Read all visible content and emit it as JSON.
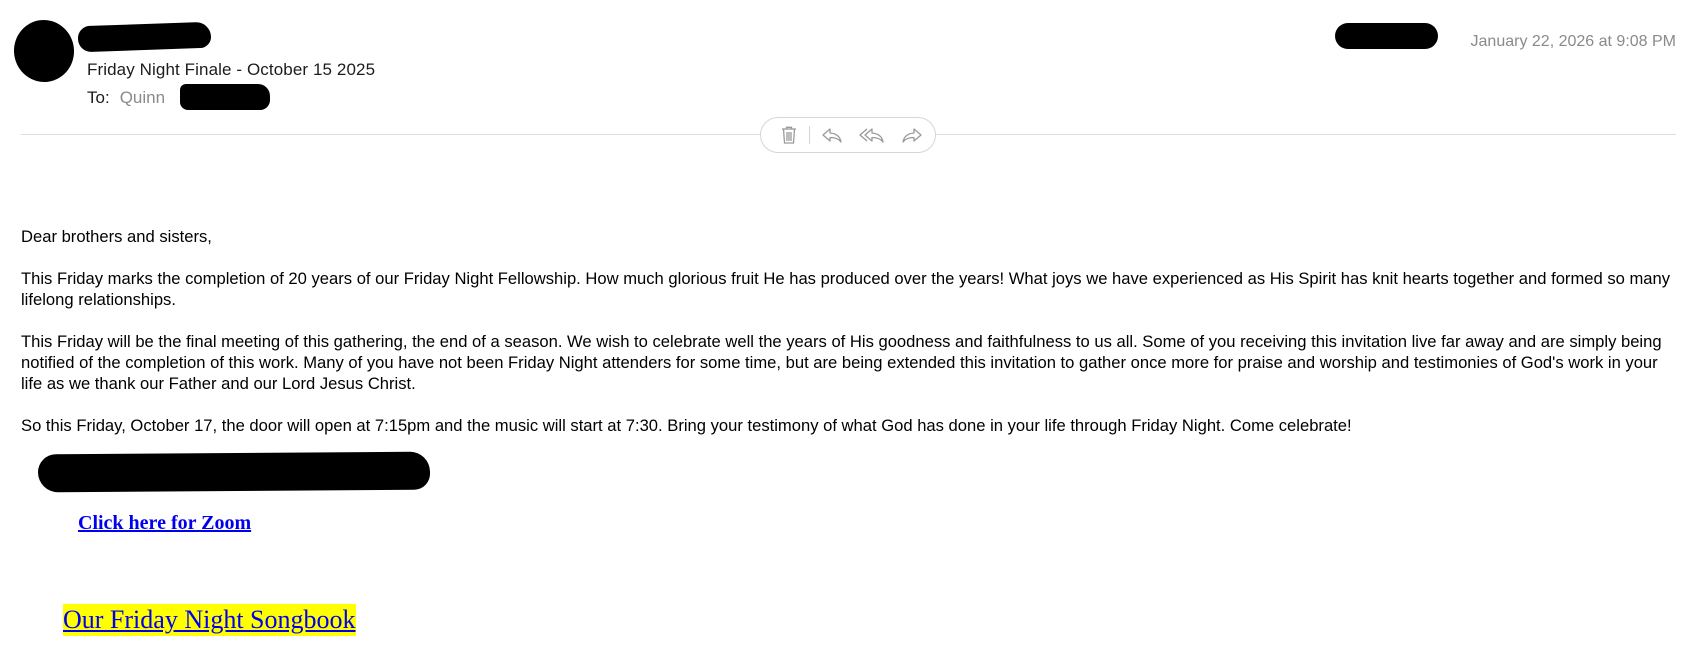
{
  "header": {
    "subject": "Friday Night Finale - October 15 2025",
    "to_label": "To:",
    "to_name": "Quinn",
    "date": "January 22, 2026 at 9:08 PM"
  },
  "toolbar": {
    "icons": [
      "trash-icon",
      "reply-icon",
      "reply-all-icon",
      "forward-icon"
    ]
  },
  "body": {
    "greeting": "Dear brothers and sisters,",
    "paragraph1": "This Friday marks the completion of 20 years of our Friday Night Fellowship. How much glorious fruit He has produced over the years! What joys we have experienced as His Spirit has knit hearts together and formed so many lifelong relationships.",
    "paragraph2": "This Friday will be the final meeting of this gathering, the end of a season. We wish to celebrate well the years of His goodness and faithfulness to us all. Some of you receiving this invitation live far away and are simply being notified of the completion of this work. Many of you have not been Friday Night attenders for some time, but are being extended this invitation to gather once more for praise and worship and testimonies of God's work in your life as we thank our Father and our Lord Jesus Christ.",
    "paragraph3": "So this Friday, October 17, the door will open at 7:15pm and the music will start at 7:30. Bring your testimony of what God has done in your life through Friday Night. Come celebrate!"
  },
  "links": {
    "zoom": "Click here for Zoom",
    "songbook": "Our Friday Night Songbook"
  },
  "colors": {
    "link": "#0000ee",
    "highlight": "#ffff00",
    "muted": "#8a8a8a"
  }
}
